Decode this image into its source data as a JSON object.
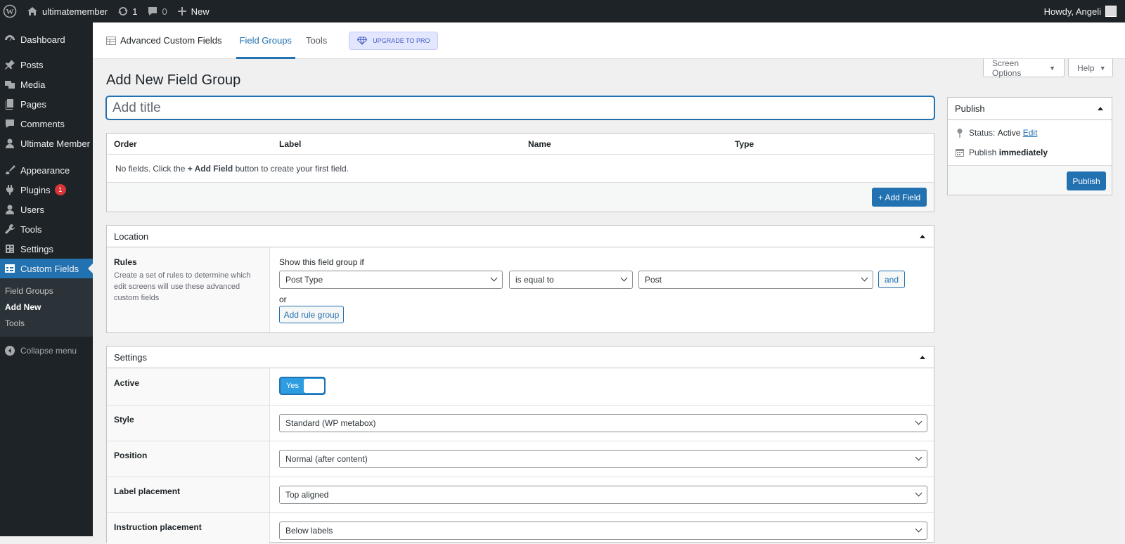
{
  "adminbar": {
    "site_name": "ultimatemember",
    "updates_count": "1",
    "comments_count": "0",
    "new_label": "New",
    "howdy": "Howdy, Angeli"
  },
  "sidebar": {
    "items": [
      {
        "label": "Dashboard",
        "icon": "dashboard-icon"
      },
      {
        "label": "Posts",
        "icon": "pin-icon"
      },
      {
        "label": "Media",
        "icon": "media-icon"
      },
      {
        "label": "Pages",
        "icon": "pages-icon"
      },
      {
        "label": "Comments",
        "icon": "comment-icon"
      },
      {
        "label": "Ultimate Member",
        "icon": "user-icon"
      },
      {
        "label": "Appearance",
        "icon": "brush-icon"
      },
      {
        "label": "Plugins",
        "icon": "plugin-icon",
        "badge": "1"
      },
      {
        "label": "Users",
        "icon": "users-icon"
      },
      {
        "label": "Tools",
        "icon": "wrench-icon"
      },
      {
        "label": "Settings",
        "icon": "settings-icon"
      },
      {
        "label": "Custom Fields",
        "icon": "table-icon"
      }
    ],
    "submenu": [
      "Field Groups",
      "Add New",
      "Tools"
    ],
    "collapse": "Collapse menu"
  },
  "acf_nav": {
    "brand": "Advanced Custom Fields",
    "tabs": [
      "Field Groups",
      "Tools"
    ],
    "upgrade": "UPGRADE TO PRO"
  },
  "screen_options": "Screen Options",
  "help": "Help",
  "page_title": "Add New Field Group",
  "title_placeholder": "Add title",
  "fields": {
    "headers": [
      "Order",
      "Label",
      "Name",
      "Type"
    ],
    "empty_prefix": "No fields. Click the ",
    "empty_button": "+ Add Field",
    "empty_suffix": " button to create your first field.",
    "add_button": "+ Add Field"
  },
  "location": {
    "title": "Location",
    "rules_label": "Rules",
    "rules_desc": "Create a set of rules to determine which edit screens will use these advanced custom fields",
    "show_if": "Show this field group if",
    "param": "Post Type",
    "operator": "is equal to",
    "value": "Post",
    "and_button": "and",
    "or_label": "or",
    "add_rule_group": "Add rule group"
  },
  "settings": {
    "title": "Settings",
    "active_label": "Active",
    "active_value": "Yes",
    "style_label": "Style",
    "style_value": "Standard (WP metabox)",
    "position_label": "Position",
    "position_value": "Normal (after content)",
    "label_placement_label": "Label placement",
    "label_placement_value": "Top aligned",
    "instruction_label": "Instruction placement",
    "instruction_value": "Below labels"
  },
  "publish": {
    "title": "Publish",
    "status_label": "Status:",
    "status_value": "Active",
    "edit_link": "Edit",
    "publish_label": "Publish",
    "publish_when": "immediately",
    "button": "Publish"
  },
  "colors": {
    "primary": "#2271b1",
    "sidebar": "#1d2327",
    "badge": "#d63638"
  }
}
